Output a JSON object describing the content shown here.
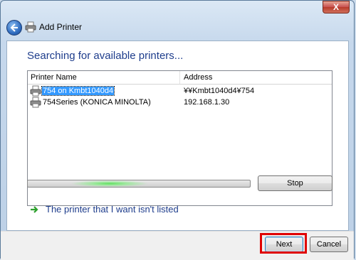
{
  "window": {
    "title": "Add Printer",
    "close_label": "X"
  },
  "main": {
    "heading": "Searching for available printers...",
    "columns": [
      "Printer Name",
      "Address"
    ],
    "printers": [
      {
        "name": "754 on Kmbt1040d4",
        "address": "¥¥Kmbt1040d4¥754",
        "selected": true
      },
      {
        "name": "754Series (KONICA MINOLTA)",
        "address": "192.168.1.30",
        "selected": false
      }
    ],
    "stop_label": "Stop",
    "not_listed_link": "The printer that I want isn't listed"
  },
  "footer": {
    "next_label": "Next",
    "cancel_label": "Cancel"
  },
  "colors": {
    "heading": "#1e3d8c",
    "selection": "#3399ff",
    "progress_glow": "#5ee05e",
    "highlight_box": "#e00000",
    "link_arrow": "#2ea02e"
  },
  "icons": {
    "back": "back-arrow-icon",
    "printer": "printer-icon",
    "link_arrow": "green-arrow-icon",
    "close": "close-icon"
  }
}
